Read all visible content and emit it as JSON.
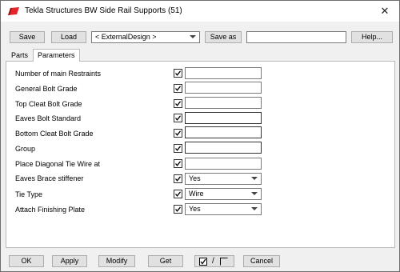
{
  "window": {
    "title": "Tekla Structures  BW Side Rail Supports (51)",
    "close_glyph": "✕",
    "brand_color": "#e3262b"
  },
  "toolbar": {
    "save_label": "Save",
    "load_label": "Load",
    "preset_selected": "< ExternalDesign >",
    "save_as_label": "Save as",
    "save_as_value": "",
    "help_label": "Help..."
  },
  "tabs": [
    {
      "label": "Parts",
      "active": false
    },
    {
      "label": "Parameters",
      "active": true
    }
  ],
  "rows": [
    {
      "label": "Number of main Restraints",
      "checked": true,
      "type": "text",
      "value": ""
    },
    {
      "label": "General Bolt Grade",
      "checked": true,
      "type": "text",
      "value": ""
    },
    {
      "label": "Top Cleat Bolt Grade",
      "checked": true,
      "type": "text",
      "value": ""
    },
    {
      "label": "Eaves Bolt Standard",
      "checked": true,
      "type": "text",
      "value": ""
    },
    {
      "label": "Bottom Cleat Bolt Grade",
      "checked": true,
      "type": "text",
      "value": ""
    },
    {
      "label": "Group",
      "checked": true,
      "type": "text",
      "value": ""
    },
    {
      "label": "Place Diagonal Tie Wire at",
      "checked": true,
      "type": "text",
      "value": ""
    },
    {
      "label": "Eaves Brace stiffener",
      "checked": true,
      "type": "select",
      "value": "Yes"
    },
    {
      "label": "Tie Type",
      "checked": true,
      "type": "select",
      "value": "Wire"
    },
    {
      "label": "Attach Finishing Plate",
      "checked": true,
      "type": "select",
      "value": "Yes"
    }
  ],
  "footer": {
    "ok_label": "OK",
    "apply_label": "Apply",
    "modify_label": "Modify",
    "get_label": "Get",
    "toggle_separator": "/",
    "cancel_label": "Cancel"
  }
}
